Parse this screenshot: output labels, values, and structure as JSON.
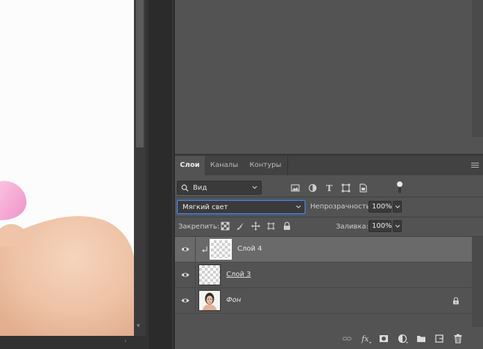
{
  "panel": {
    "tabs": [
      "Слои",
      "Каналы",
      "Контуры"
    ],
    "active_tab": 0,
    "menu_icon": "hamburger-menu-icon"
  },
  "filter": {
    "kind_label": "Вид",
    "icons": [
      "image-filter-icon",
      "adjustment-filter-icon",
      "type-filter-icon",
      "shape-filter-icon",
      "smart-object-filter-icon"
    ]
  },
  "blend": {
    "mode": "Мягкий свет",
    "opacity_label": "Непрозрачность:",
    "opacity_value": "100%"
  },
  "lock": {
    "label": "Закрепить:",
    "icons": [
      "lock-transparent-pixels-icon",
      "lock-image-pixels-icon",
      "lock-position-icon",
      "lock-artboard-icon",
      "lock-all-icon"
    ],
    "fill_label": "Заливка:",
    "fill_value": "100%"
  },
  "layers": [
    {
      "name": "Слой 4",
      "visible": true,
      "selected": true,
      "clipped": true,
      "thumb": "transparent"
    },
    {
      "name": "Слой 3",
      "visible": true,
      "selected": false,
      "clipped": false,
      "thumb": "transparent"
    },
    {
      "name": "Фон",
      "visible": true,
      "selected": false,
      "clipped": false,
      "thumb": "portrait",
      "locked": true
    }
  ],
  "bottom_icons": [
    "link-layers-icon",
    "fx-layer-style-icon",
    "add-mask-icon",
    "adjustment-layer-icon",
    "new-group-icon",
    "new-layer-icon",
    "delete-layer-icon"
  ],
  "colors": {
    "panel_bg": "#535353",
    "selected_row": "#6a6a6a",
    "focus_border": "#5a8bd6",
    "skin": "#f0c8ad",
    "nail": "#f4a6d2"
  }
}
